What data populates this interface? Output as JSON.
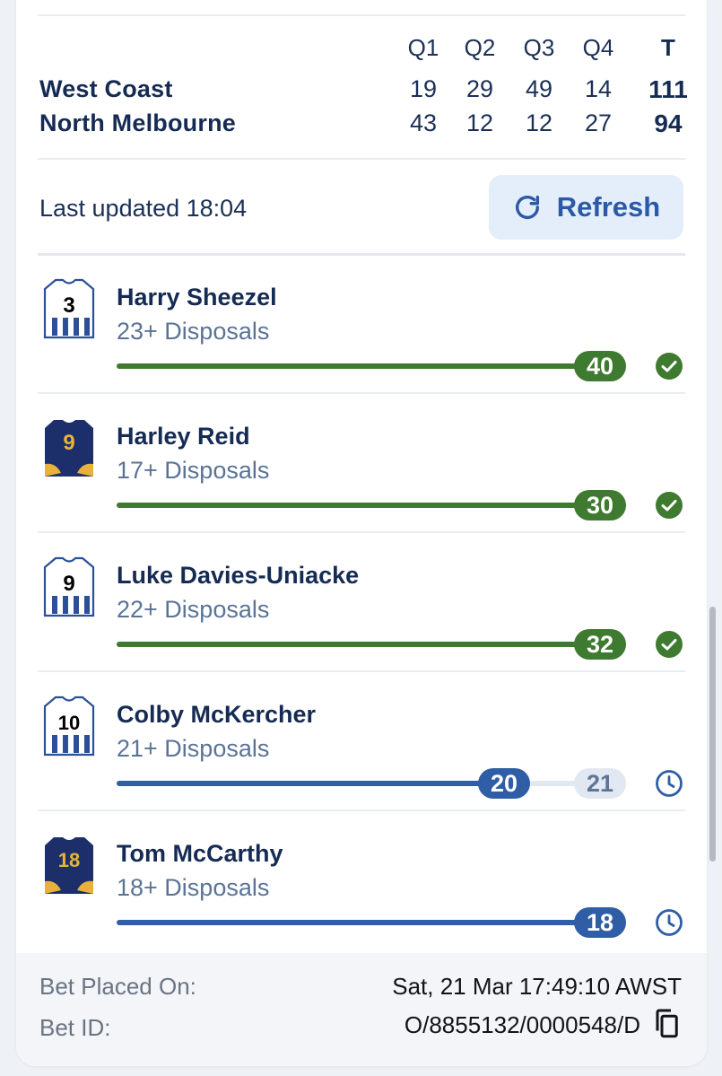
{
  "scoreboard": {
    "headers": [
      "Q1",
      "Q2",
      "Q3",
      "Q4"
    ],
    "total_header": "T",
    "teams": [
      {
        "name": "West Coast",
        "quarters": [
          "19",
          "29",
          "49",
          "14"
        ],
        "total": "111"
      },
      {
        "name": "North Melbourne",
        "quarters": [
          "43",
          "12",
          "12",
          "27"
        ],
        "total": "94"
      }
    ]
  },
  "status": {
    "last_updated": "Last updated 18:04"
  },
  "refresh": {
    "label": "Refresh",
    "icon": "refresh-icon"
  },
  "legs": [
    {
      "player": "Harry Sheezel",
      "market": "23+ Disposals",
      "jersey_number": "3",
      "team": "North Melbourne",
      "current": 40,
      "target": 23,
      "progress": 1.0,
      "status": "won",
      "status_icon": "check-circle-icon"
    },
    {
      "player": "Harley Reid",
      "market": "17+ Disposals",
      "jersey_number": "9",
      "team": "West Coast",
      "current": 30,
      "target": 17,
      "progress": 1.0,
      "status": "won",
      "status_icon": "check-circle-icon"
    },
    {
      "player": "Luke Davies-Uniacke",
      "market": "22+ Disposals",
      "jersey_number": "9",
      "team": "North Melbourne",
      "current": 32,
      "target": 22,
      "progress": 1.0,
      "status": "won",
      "status_icon": "check-circle-icon"
    },
    {
      "player": "Colby McKercher",
      "market": "21+ Disposals",
      "jersey_number": "10",
      "team": "North Melbourne",
      "current": 20,
      "target": 21,
      "progress": 0.952,
      "status": "pending",
      "status_icon": "clock-icon",
      "target_label": "21"
    },
    {
      "player": "Tom McCarthy",
      "market": "18+ Disposals",
      "jersey_number": "18",
      "team": "West Coast",
      "current": 18,
      "target": 18,
      "progress": 1.0,
      "status": "pending",
      "status_icon": "clock-icon"
    }
  ],
  "footer": {
    "placed_label": "Bet Placed On:",
    "placed_value": "Sat, 21 Mar 17:49:10 AWST",
    "id_label": "Bet ID:",
    "id_value": "O/8855132/0000548/D",
    "copy_icon": "copy-icon"
  },
  "colors": {
    "won": "#3e7a2f",
    "pending": "#2f5ea6",
    "north_melbourne_stripe": "#2b4f98",
    "west_coast_navy": "#1c2f6b",
    "west_coast_gold": "#e8b23a"
  }
}
